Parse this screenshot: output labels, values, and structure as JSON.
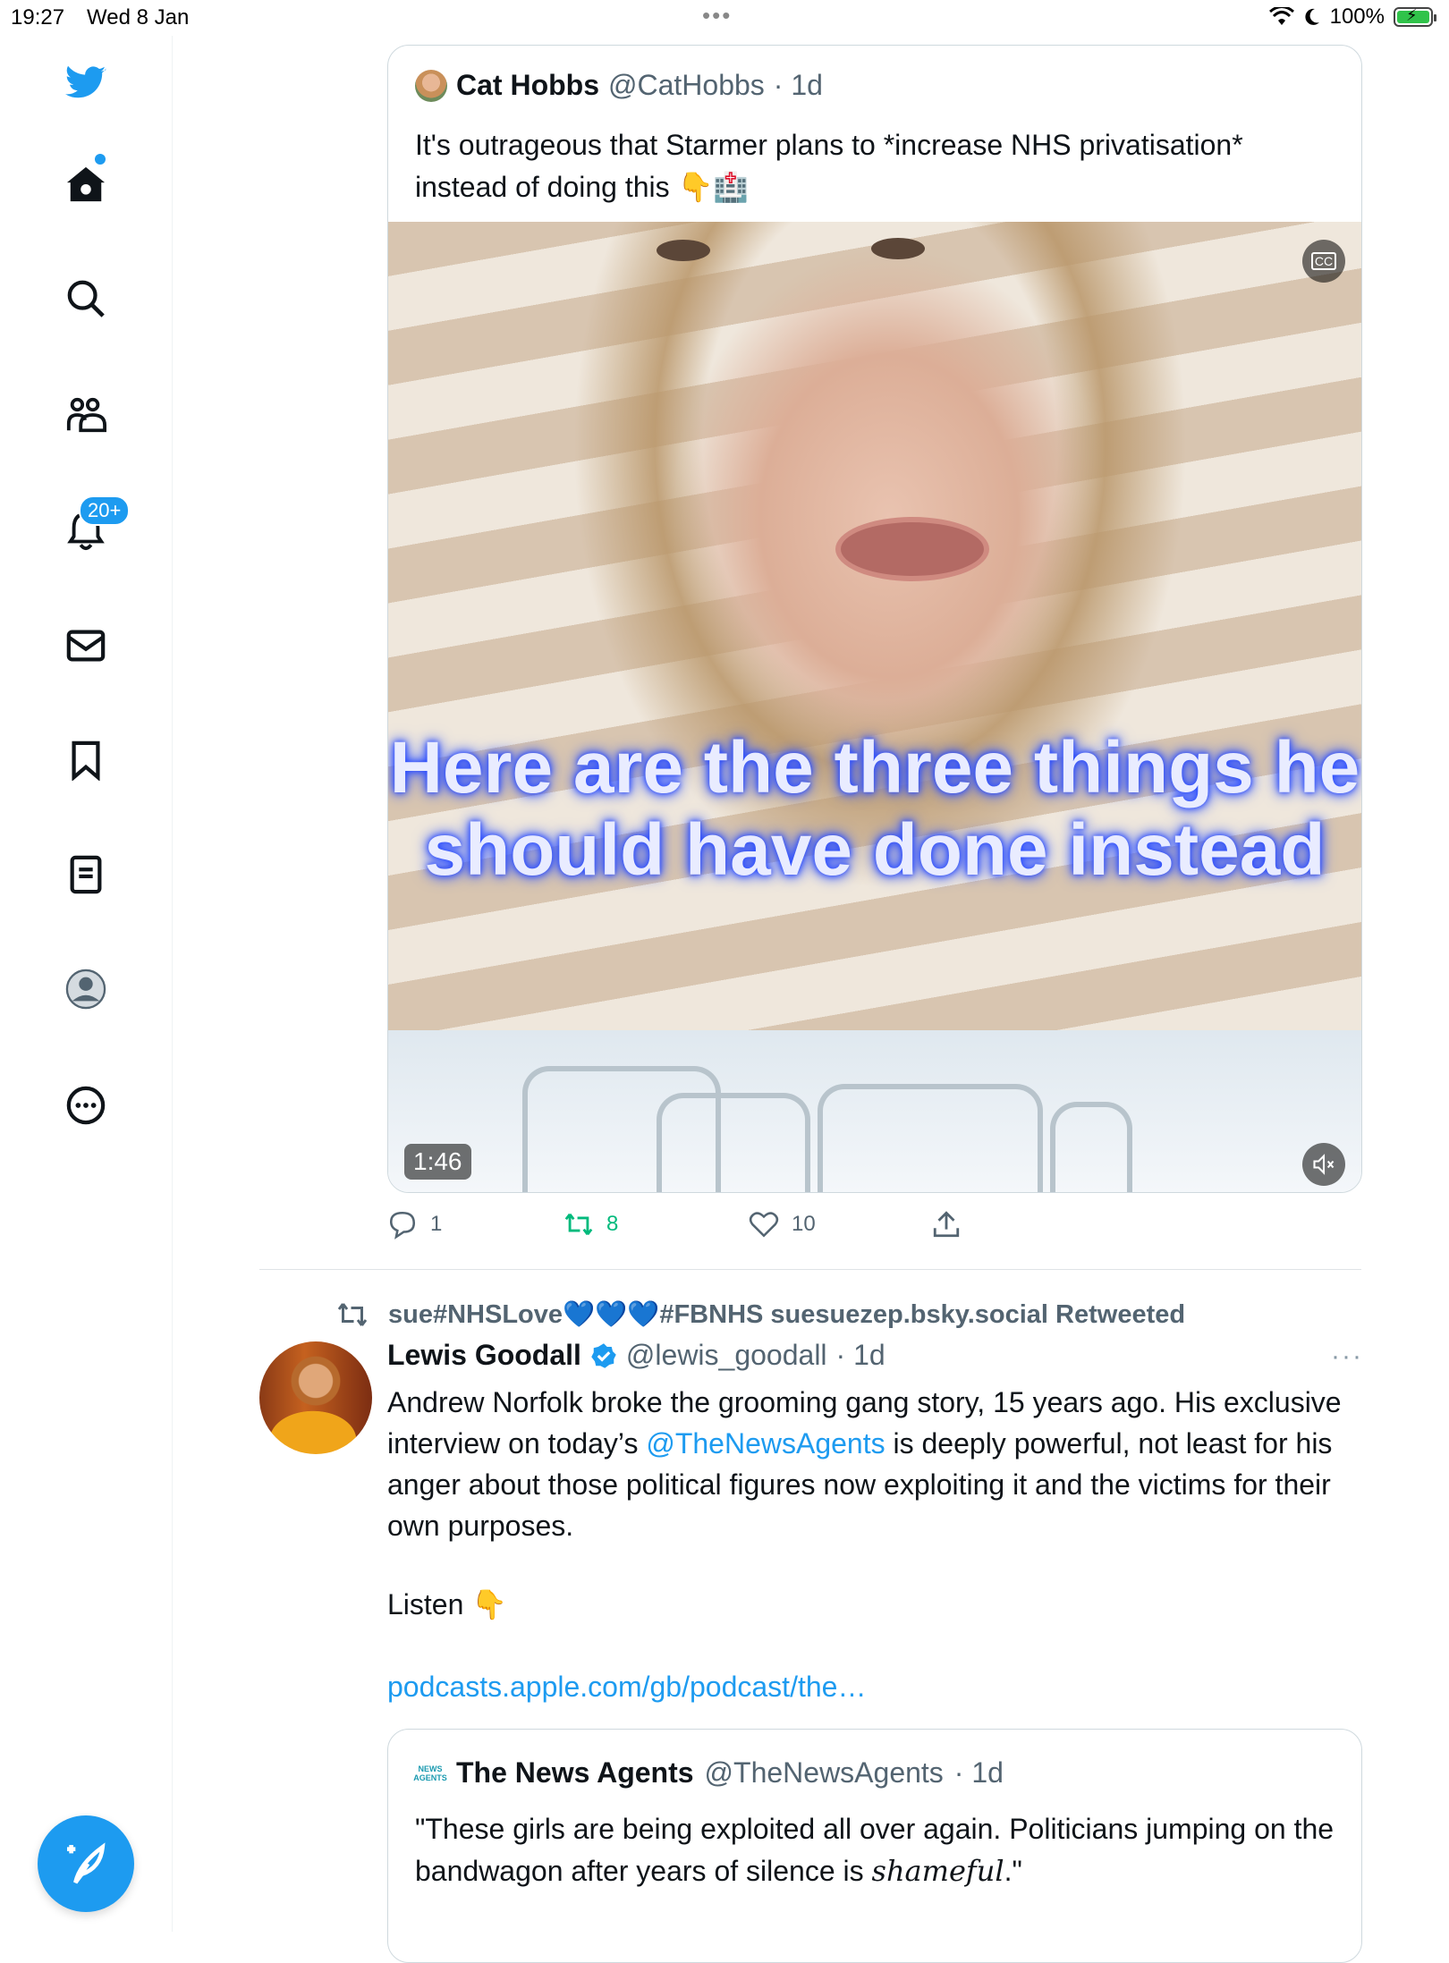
{
  "status_bar": {
    "time": "19:27",
    "date": "Wed 8 Jan",
    "dots": "•••",
    "battery": "100%"
  },
  "sidebar": {
    "items": [
      {
        "icon": "twitter-bird-icon"
      },
      {
        "icon": "home-icon"
      },
      {
        "icon": "search-icon"
      },
      {
        "icon": "communities-icon"
      },
      {
        "icon": "notifications-bell-icon"
      },
      {
        "icon": "messages-mail-icon"
      },
      {
        "icon": "bookmark-icon"
      },
      {
        "icon": "lists-icon"
      },
      {
        "icon": "profile-icon"
      },
      {
        "icon": "more-circle-icon"
      }
    ],
    "notification_badge": "20+",
    "compose_icon": "compose-feather-icon"
  },
  "tweet1": {
    "quoted": {
      "author_name": "Cat Hobbs",
      "handle": "@CatHobbs",
      "time": "· 1d",
      "text": "It's outrageous that Starmer plans to *increase NHS privatisation* instead of doing this 👇🏥",
      "video": {
        "caption": "Here are the three things he should have done instead",
        "duration": "1:46",
        "cc_label": "CC"
      }
    },
    "actions": {
      "replies": "1",
      "retweets": "8",
      "likes": "10"
    }
  },
  "tweet2": {
    "retweeted_by": "sue#NHSLove💙💙💙#FBNHS suesuezep.bsky.social Retweeted",
    "author_name": "Lewis Goodall",
    "handle": "@lewis_goodall",
    "time": "· 1d",
    "more": "···",
    "text_part1": "Andrew Norfolk broke the grooming gang story, 15 years ago. His exclusive interview on today’s ",
    "mention": "@TheNewsAgents",
    "text_part2": " is deeply powerful, not least for his anger about those political figures now exploiting it and the victims for their own purposes.",
    "listen": "Listen 👇",
    "link": "podcasts.apple.com/gb/podcast/the…",
    "quoted": {
      "logo_text": "NEWS AGENTS",
      "author_name": "The News Agents",
      "handle": "@TheNewsAgents",
      "time": "· 1d",
      "text_part1": "\"These girls are being exploited all over again. Politicians jumping on the bandwagon after years of silence is ",
      "text_em": "shameful",
      "text_part2": ".\""
    }
  },
  "colors": {
    "accent": "#1d9bf0",
    "retweet_green": "#00ba7c",
    "muted": "#536471",
    "border": "#cfd9de"
  }
}
